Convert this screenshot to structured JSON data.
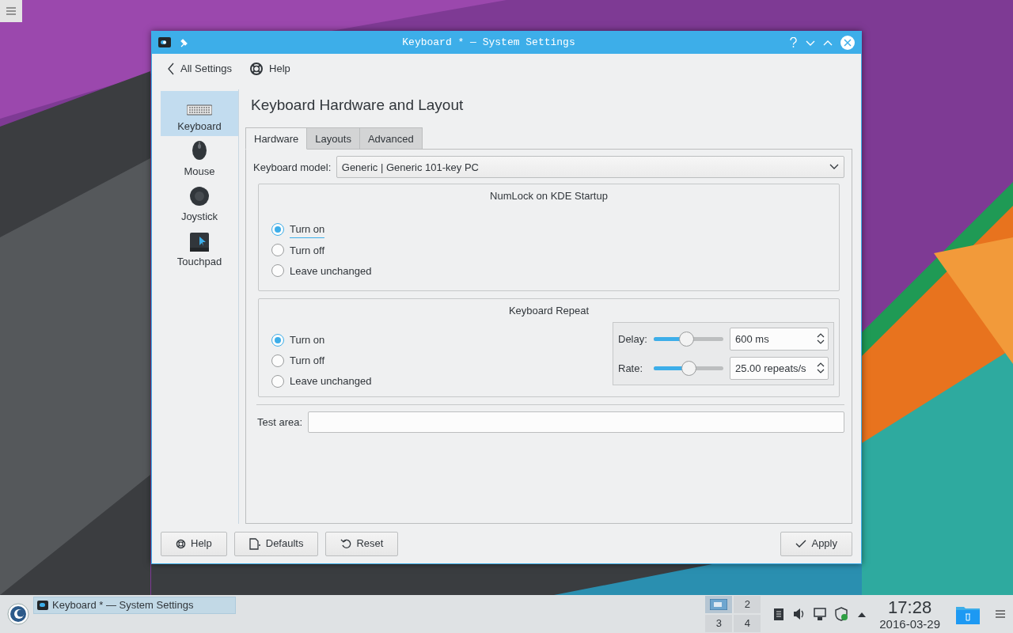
{
  "window": {
    "title": "Keyboard * — System Settings"
  },
  "toolbar": [
    {
      "label": "All Settings",
      "kind": "back"
    },
    {
      "label": "Help",
      "kind": "help"
    }
  ],
  "sidebar": {
    "items": [
      {
        "label": "Keyboard",
        "selected": true
      },
      {
        "label": "Mouse",
        "selected": false
      },
      {
        "label": "Joystick",
        "selected": false
      },
      {
        "label": "Touchpad",
        "selected": false
      }
    ]
  },
  "page_title": "Keyboard Hardware and Layout",
  "tabs": [
    {
      "label": "Hardware",
      "selected": true
    },
    {
      "label": "Layouts",
      "selected": false
    },
    {
      "label": "Advanced",
      "selected": false
    }
  ],
  "keyboard_model": {
    "label": "Keyboard model:",
    "value": "Generic | Generic 101-key PC"
  },
  "numlock": {
    "title": "NumLock on KDE Startup",
    "options": [
      {
        "label": "Turn on",
        "selected": true,
        "focused": true
      },
      {
        "label": "Turn off",
        "selected": false,
        "focused": false
      },
      {
        "label": "Leave unchanged",
        "selected": false,
        "focused": false
      }
    ]
  },
  "repeat": {
    "title": "Keyboard Repeat",
    "options": [
      {
        "label": "Turn on",
        "selected": true
      },
      {
        "label": "Turn off",
        "selected": false
      },
      {
        "label": "Leave unchanged",
        "selected": false
      }
    ],
    "sliders": [
      {
        "label": "Delay:",
        "level": 0.47,
        "value": "600 ms"
      },
      {
        "label": "Rate:",
        "level": 0.5,
        "value": "25.00 repeats/s"
      }
    ]
  },
  "test_area": {
    "label": "Test area:"
  },
  "buttons_left": [
    {
      "label": "Help",
      "kind": "help"
    },
    {
      "label": "Defaults",
      "kind": "defaults"
    },
    {
      "label": "Reset",
      "kind": "reset"
    }
  ],
  "buttons_right": [
    {
      "label": "Apply",
      "kind": "apply"
    }
  ],
  "taskbar": {
    "task": {
      "title": "Keyboard * — System Settings",
      "selected": true
    },
    "pager": [
      {
        "selected": true
      },
      {
        "label": "2",
        "selected": false
      },
      {
        "label": "3",
        "selected": false
      },
      {
        "label": "4",
        "selected": false
      }
    ],
    "clock": {
      "time": "17:28",
      "date": "2016-03-29"
    }
  }
}
